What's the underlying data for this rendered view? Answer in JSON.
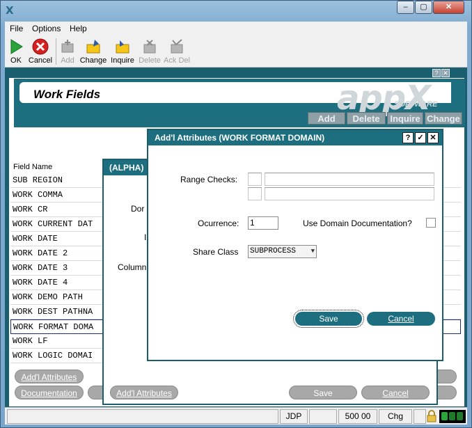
{
  "window": {
    "icon_glyph": "X",
    "controls": {
      "minimize": "–",
      "maximize": "▢",
      "close": "✕"
    }
  },
  "menubar": {
    "items": [
      "File",
      "Options",
      "Help"
    ]
  },
  "toolbar": {
    "items": [
      {
        "label": "OK",
        "icon": "ok-arrow-icon",
        "enabled": true
      },
      {
        "label": "Cancel",
        "icon": "cancel-x-icon",
        "enabled": true
      },
      {
        "label": "Add",
        "icon": "add-icon",
        "enabled": false
      },
      {
        "label": "Change",
        "icon": "change-icon",
        "enabled": true
      },
      {
        "label": "Inquire",
        "icon": "inquire-icon",
        "enabled": true
      },
      {
        "label": "Delete",
        "icon": "delete-icon",
        "enabled": false
      },
      {
        "label": "Ack Del",
        "icon": "ack-delete-icon",
        "enabled": false
      }
    ],
    "colors": {
      "ok": "#2aa33a",
      "cancel": "#d42020",
      "folder": "#f5c518",
      "disabled": "#a8a8a8"
    }
  },
  "form": {
    "mini_controls": [
      "?",
      "✕"
    ],
    "title": "Work Fields",
    "logo": {
      "main": "appX",
      "sub": "SOFTWARE"
    },
    "mode_tabs": [
      "Add",
      "Delete",
      "Inquire",
      "Change"
    ],
    "list_header": "Field Name",
    "rows": [
      "SUB REGION",
      "WORK COMMA",
      "WORK CR",
      "WORK CURRENT DAT",
      "WORK DATE",
      "WORK DATE 2",
      "WORK DATE 3",
      "WORK DATE 4",
      "WORK DEMO PATH",
      "WORK DEST PATHNA",
      "WORK FORMAT DOMA",
      "WORK LF",
      "WORK LOGIC DOMAI"
    ],
    "selected_row": 10,
    "bottom_buttons": {
      "addl_attributes": "Add'l Attributes",
      "documentation": "Documentation"
    }
  },
  "alpha_dialog": {
    "title": "(ALPHA)",
    "partial_labels": [
      "Dor",
      "I",
      "Column"
    ],
    "buttons": {
      "addl_attributes": "Add'l Attributes",
      "save": "Save",
      "cancel": "Cancel"
    }
  },
  "addl_dialog": {
    "title": "Add'l Attributes  (WORK FORMAT DOMAIN)",
    "controls": {
      "help": "?",
      "ok": "✓",
      "close": "✕"
    },
    "range_checks_label": "Range Checks:",
    "range_checks": [
      {
        "flag": "",
        "value": ""
      },
      {
        "flag": "",
        "value": ""
      }
    ],
    "occurrence_label": "Ocurrence:",
    "occurrence_value": "1",
    "use_domain_doc_label": "Use Domain Documentation?",
    "use_domain_doc_checked": false,
    "share_class_label": "Share Class",
    "share_class_value": "SUBPROCESS",
    "save_label": "Save",
    "cancel_label": "Cancel"
  },
  "statusbar": {
    "user": "JDP",
    "value": "500 00",
    "mode": "Chg",
    "leds": [
      "#2aa33a",
      "#1f7a2a",
      "#1f7a2a"
    ]
  }
}
